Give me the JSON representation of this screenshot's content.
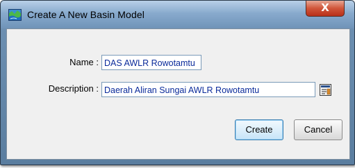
{
  "window": {
    "title": "Create A New Basin Model",
    "close_label": "X"
  },
  "form": {
    "name_label": "Name :",
    "name_value": "DAS AWLR Rowotamtu",
    "description_label": "Description :",
    "description_value": "Daerah Aliran Sungai AWLR Rowotamtu"
  },
  "buttons": {
    "create_label": "Create",
    "cancel_label": "Cancel"
  },
  "icons": {
    "title": "basin-model-icon",
    "description_editor": "edit-text-icon"
  },
  "colors": {
    "field_text": "#0a2a9a",
    "close_button": "#c8402a",
    "titlebar": "#88aacd"
  }
}
